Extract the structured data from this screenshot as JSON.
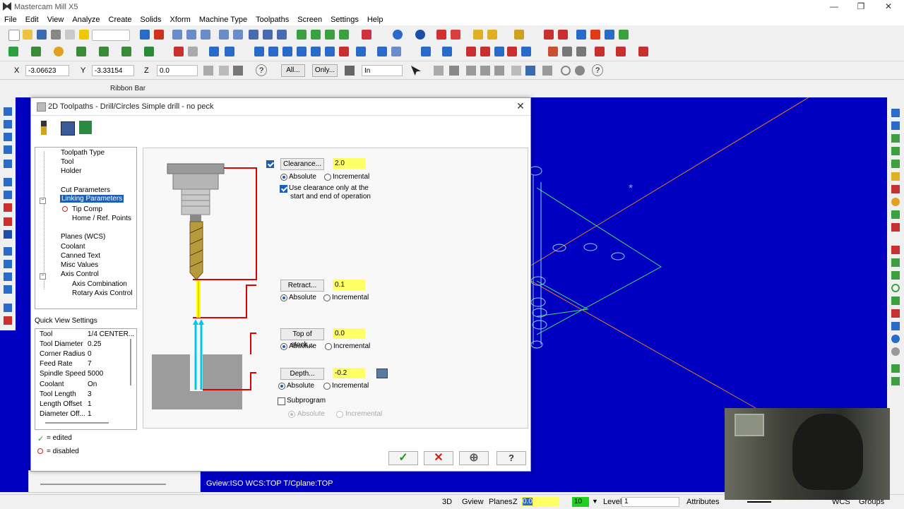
{
  "app": {
    "title": "Mastercam Mill X5"
  },
  "menu": [
    "File",
    "Edit",
    "View",
    "Analyze",
    "Create",
    "Solids",
    "Xform",
    "Machine Type",
    "Toolpaths",
    "Screen",
    "Settings",
    "Help"
  ],
  "ribbon": {
    "x_label": "X",
    "x_value": "-3.06623",
    "y_label": "Y",
    "y_value": "-3.33154",
    "z_label": "Z",
    "z_value": "0.0",
    "all_button": "All...",
    "only_button": "Only...",
    "in_select": "In",
    "bar_label": "Ribbon Bar"
  },
  "dialog": {
    "title": "2D Toolpaths - Drill/Circles Simple drill - no peck",
    "close": "✕",
    "tree": [
      "Toolpath Type",
      "Tool",
      "Holder",
      "Cut Parameters",
      "Linking Parameters",
      "Tip Comp",
      "Home / Ref. Points",
      "Planes (WCS)",
      "Coolant",
      "Canned Text",
      "Misc Values",
      "Axis Control",
      "Axis Combination",
      "Rotary Axis Control"
    ],
    "quick_view_label": "Quick View Settings",
    "quick_view": [
      {
        "k": "Tool",
        "v": "1/4 CENTER..."
      },
      {
        "k": "Tool Diameter",
        "v": "0.25"
      },
      {
        "k": "Corner Radius",
        "v": "0"
      },
      {
        "k": "Feed Rate",
        "v": "7"
      },
      {
        "k": "Spindle Speed",
        "v": "5000"
      },
      {
        "k": "Coolant",
        "v": "On"
      },
      {
        "k": "Tool Length",
        "v": "3"
      },
      {
        "k": "Length Offset",
        "v": "1"
      },
      {
        "k": "Diameter Off...",
        "v": "1"
      }
    ],
    "legend_edited": "= edited",
    "legend_disabled": "= disabled",
    "clearance": {
      "label": "Clearance...",
      "value": "2.0",
      "checked": true,
      "absolute": "Absolute",
      "incremental": "Incremental"
    },
    "use_clearance": {
      "line1": "Use clearance only at the",
      "line2": "start and end of operation",
      "checked": true
    },
    "retract": {
      "label": "Retract...",
      "value": "0.1",
      "absolute": "Absolute",
      "incremental": "Incremental"
    },
    "top_of_stock": {
      "label": "Top of stock...",
      "value": "0.0",
      "absolute": "Absolute",
      "incremental": "Incremental"
    },
    "depth": {
      "label": "Depth...",
      "value": "-0.2",
      "absolute": "Absolute",
      "incremental": "Incremental"
    },
    "subprogram": {
      "label": "Subprogram",
      "checked": false,
      "absolute": "Absolute",
      "incremental": "Incremental"
    }
  },
  "graphics": {
    "gview_info": "Gview:ISO   WCS:TOP   T/Cplane:TOP",
    "background": "#0000c0"
  },
  "status": {
    "d3": "3D",
    "gview": "Gview",
    "planes": "Planes",
    "z": "Z",
    "z_value": "0.0",
    "color_value": "10",
    "level_label": "Level",
    "level_value": "1",
    "attributes": "Attributes",
    "wcs": "WCS",
    "groups": "Groups"
  },
  "colors": {
    "accent": "#1a5fb4",
    "highlight": "#ffff66",
    "path_red": "#e00000",
    "rapid_yellow": "#ffff00",
    "feed_cyan": "#00c8e6"
  }
}
